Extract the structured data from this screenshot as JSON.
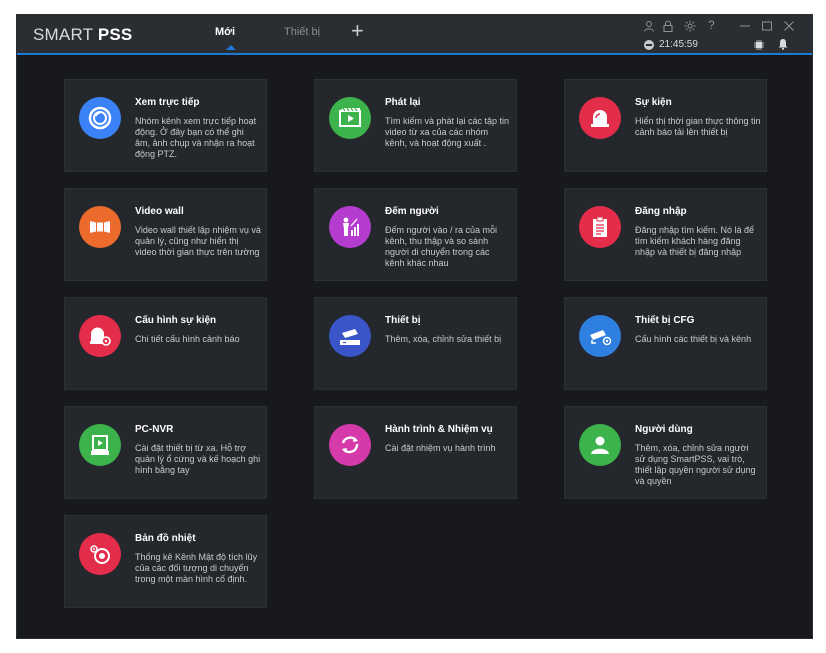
{
  "app": {
    "logo_main": "SMART ",
    "logo_bold": "PSS"
  },
  "tabs": [
    {
      "label": "Mới"
    },
    {
      "label": "Thiết bị"
    }
  ],
  "clock": {
    "time": "21:45:59"
  },
  "cards": [
    {
      "title": "Xem trực tiếp",
      "desc": "Nhóm kênh xem trực tiếp hoạt động. Ở đây bạn có thể ghi âm, ảnh chụp và nhận ra hoạt động PTZ.",
      "color": "#3a82f6",
      "icon": "live-view-icon"
    },
    {
      "title": "Phát lại",
      "desc": "Tìm kiếm và phát lại các tập tin video từ xa của các nhóm kênh, và hoạt động xuất .",
      "color": "#3cb44b",
      "icon": "playback-icon"
    },
    {
      "title": "Sự kiện",
      "desc": "Hiển thị thời gian thực thông tin cảnh báo tải lên thiết bị",
      "color": "#e32d4a",
      "icon": "event-alarm-icon"
    },
    {
      "title": "Video wall",
      "desc": "Video wall thiết lập nhiệm vụ và quản lý, cũng như hiển thị video thời gian thực trên tường",
      "color": "#ec6a2c",
      "icon": "video-wall-icon"
    },
    {
      "title": "Đếm người",
      "desc": "Đếm người vào / ra của mỗi kênh, thu thập và so sánh người di chuyển trong các kênh khác nhau",
      "color": "#b43ccf",
      "icon": "people-count-icon"
    },
    {
      "title": "Đăng nhập",
      "desc": "Đăng nhập tìm kiếm. Nó là để tìm kiếm khách hàng đăng nhập và thiết bị đăng nhập",
      "color": "#e32d4a",
      "icon": "clipboard-icon"
    },
    {
      "title": "Cấu hình sự kiện",
      "desc": "Chi tiết cấu hình cảnh báo",
      "color": "#e32d4a",
      "icon": "event-config-icon"
    },
    {
      "title": "Thiết bị",
      "desc": "Thêm, xóa, chỉnh sửa thiết bị",
      "color": "#3a55c8",
      "icon": "device-icon"
    },
    {
      "title": "Thiết bị CFG",
      "desc": "Cấu hình các thiết bị và kênh",
      "color": "#2f7fe0",
      "icon": "device-config-icon"
    },
    {
      "title": "PC-NVR",
      "desc": "Cài đặt thiết bị từ xa. Hỗ trợ quản lý ổ cứng và kế hoạch ghi hình bằng tay",
      "color": "#3cb44b",
      "icon": "pc-nvr-icon"
    },
    {
      "title": "Hành trình & Nhiệm vụ",
      "desc": "Cài đặt nhiệm vụ hành trình",
      "color": "#d63aaa",
      "icon": "tour-task-icon"
    },
    {
      "title": "Người dùng",
      "desc": "Thêm, xóa, chỉnh sửa người sử dụng SmartPSS, vai trò, thiết lập quyền người sử dụng và quyền",
      "color": "#3cb44b",
      "icon": "user-icon"
    },
    {
      "title": "Bản đồ nhiệt",
      "desc": "Thống kê Kênh Mật độ tích lũy của các đối tượng di chuyển trong một màn hình cố định.",
      "color": "#e32d4a",
      "icon": "heat-map-icon"
    }
  ]
}
